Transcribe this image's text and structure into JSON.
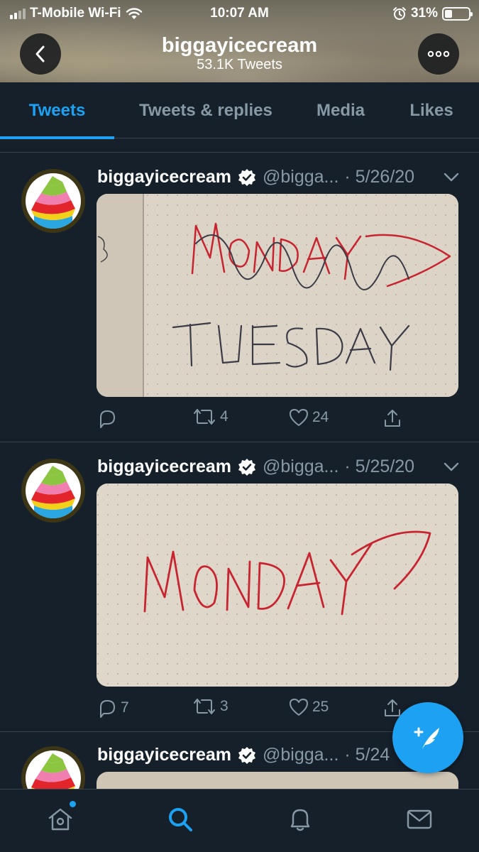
{
  "status": {
    "carrier": "T-Mobile Wi-Fi",
    "time": "10:07 AM",
    "battery": "31%",
    "battery_level": 0.31
  },
  "profile": {
    "name": "biggayicecream",
    "tweet_count": "53.1K Tweets"
  },
  "tabs": [
    {
      "label": "Tweets",
      "active": true
    },
    {
      "label": "Tweets & replies",
      "active": false
    },
    {
      "label": "Media",
      "active": false
    },
    {
      "label": "Likes",
      "active": false
    }
  ],
  "tweets": [
    {
      "name": "biggayicecream",
      "handle": "@bigga...",
      "date": "· 5/26/20",
      "image_text": [
        "MONDAY",
        "TUESDAY"
      ],
      "replies": "",
      "retweets": "4",
      "likes": "24"
    },
    {
      "name": "biggayicecream",
      "handle": "@bigga...",
      "date": "· 5/25/20",
      "image_text": [
        "MONDAY"
      ],
      "replies": "7",
      "retweets": "3",
      "likes": "25"
    },
    {
      "name": "biggayicecream",
      "handle": "@bigga...",
      "date": "· 5/24"
    }
  ],
  "icons": {
    "back": "chevron-left-icon",
    "more": "more-horizontal-icon",
    "verified": "verified-badge-icon",
    "reply": "reply-icon",
    "retweet": "retweet-icon",
    "like": "heart-icon",
    "share": "share-icon",
    "compose": "compose-tweet-icon",
    "home": "home-icon",
    "search": "search-icon",
    "notifications": "bell-icon",
    "messages": "mail-icon"
  },
  "colors": {
    "background": "#15202b",
    "accent": "#1da1f2",
    "muted": "#8899a6",
    "divider": "#38444d"
  }
}
